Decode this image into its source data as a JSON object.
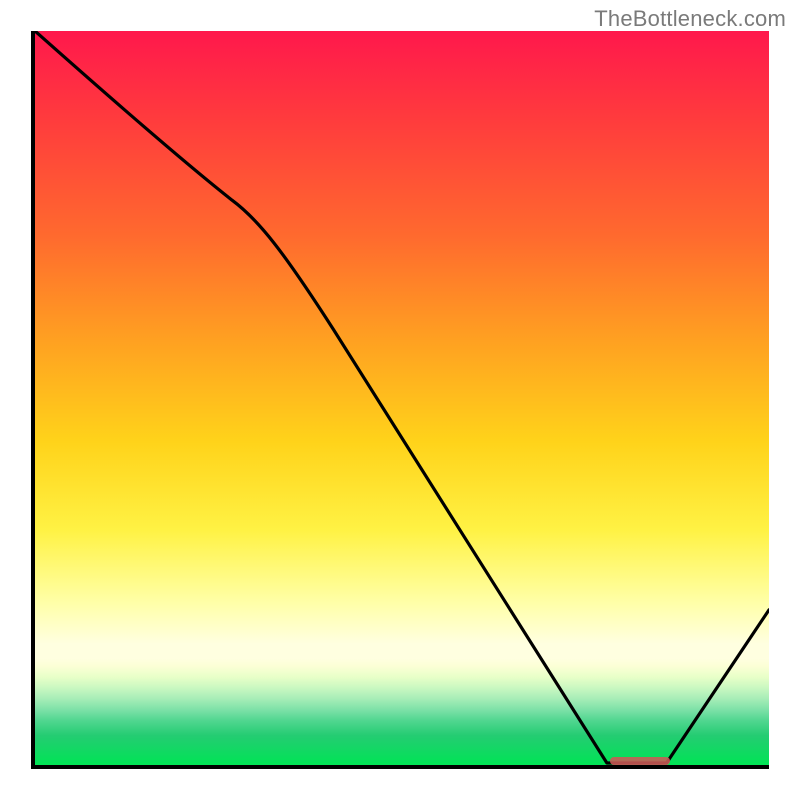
{
  "attribution": "TheBottleneck.com",
  "colors": {
    "gradient_top": "#ff184c",
    "gradient_mid": "#ffd31a",
    "gradient_bottom": "#00e455",
    "curve": "#000000",
    "axis": "#000000",
    "marker": "#cc5a57"
  },
  "chart_data": {
    "type": "line",
    "title": "",
    "xlabel": "",
    "ylabel": "",
    "xlim": [
      0,
      100
    ],
    "ylim": [
      0,
      100
    ],
    "x": [
      0,
      26.8,
      78,
      86,
      100
    ],
    "values": [
      100,
      77,
      0,
      0,
      21
    ],
    "marker_segment": {
      "x_start": 78,
      "x_end": 86,
      "y": 0
    }
  }
}
